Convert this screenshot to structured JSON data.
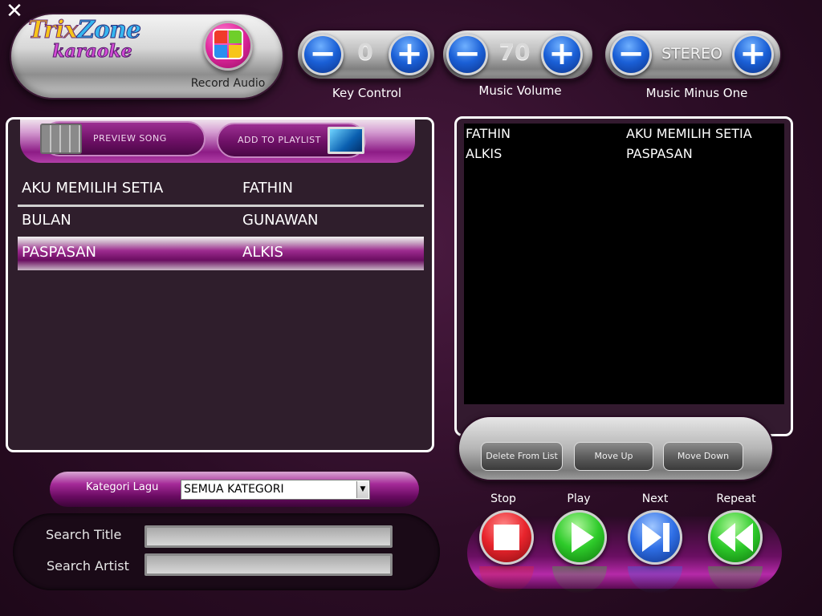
{
  "window": {
    "close_glyph": "✕"
  },
  "logo": {
    "line1a": "Trix",
    "line1b": "Zone",
    "line2": "karaoke"
  },
  "record": {
    "label": "Record Audio",
    "icon": "record-audio-icon"
  },
  "controls": {
    "minus_glyph": "−",
    "plus_glyph": "+",
    "key": {
      "value": "0",
      "label": "Key Control"
    },
    "volume": {
      "value": "70",
      "label": "Music Volume"
    },
    "minus_one": {
      "value": "STEREO",
      "label": "Music Minus One"
    }
  },
  "song_toolbar": {
    "preview": "PREVIEW SONG",
    "add": "ADD TO PLAYLIST"
  },
  "songs": [
    {
      "title": "AKU MEMILIH SETIA",
      "artist": "FATHIN"
    },
    {
      "title": "BULAN",
      "artist": "GUNAWAN"
    },
    {
      "title": "PASPASAN",
      "artist": "ALKIS"
    }
  ],
  "playlist": [
    {
      "artist": "FATHIN",
      "title": "AKU MEMILIH SETIA"
    },
    {
      "artist": "ALKIS",
      "title": "PASPASAN"
    }
  ],
  "playlist_tools": {
    "delete": "Delete From List",
    "up": "Move Up",
    "down": "Move Down"
  },
  "category": {
    "label": "Kategori Lagu",
    "selected": "SEMUA KATEGORI",
    "arrow": "▼"
  },
  "search": {
    "title_label": "Search Title",
    "artist_label": "Search Artist",
    "title_value": "",
    "artist_value": ""
  },
  "transport": {
    "stop": "Stop",
    "play": "Play",
    "next": "Next",
    "repeat": "Repeat"
  },
  "colors": {
    "stop": "#e8242c",
    "play": "#2ecb2a",
    "next": "#2f6fe6",
    "repeat": "#2ecb2a",
    "accent": "#9c2a8e"
  }
}
